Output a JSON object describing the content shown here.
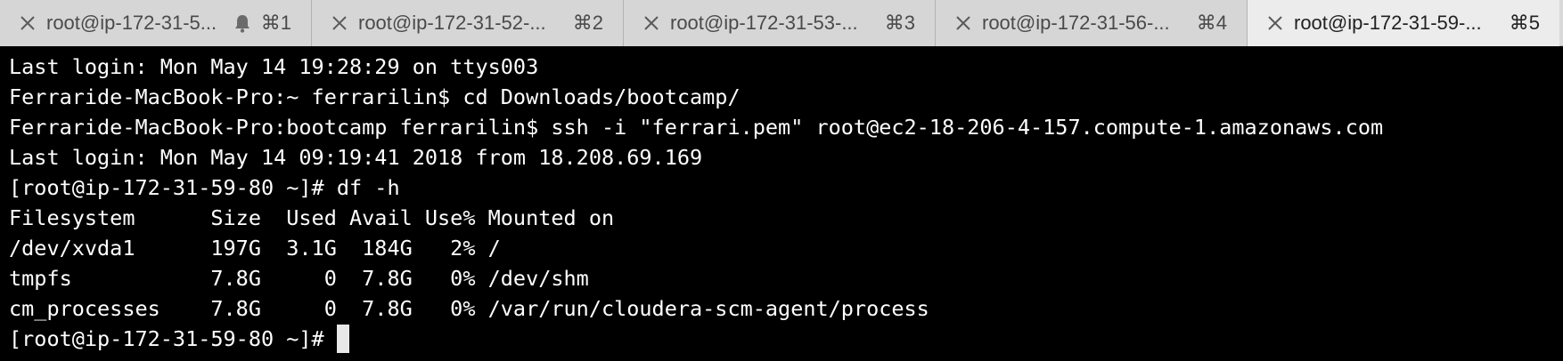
{
  "tabs": [
    {
      "title": "root@ip-172-31-5...",
      "shortcut": "⌘1",
      "active": false,
      "has_bell": true
    },
    {
      "title": "root@ip-172-31-52-...",
      "shortcut": "⌘2",
      "active": false,
      "has_bell": false
    },
    {
      "title": "root@ip-172-31-53-...",
      "shortcut": "⌘3",
      "active": false,
      "has_bell": false
    },
    {
      "title": "root@ip-172-31-56-...",
      "shortcut": "⌘4",
      "active": false,
      "has_bell": false
    },
    {
      "title": "root@ip-172-31-59-...",
      "shortcut": "⌘5",
      "active": true,
      "has_bell": false
    }
  ],
  "icons": {
    "close": "close-icon",
    "bell": "bell-icon"
  },
  "terminal": {
    "lines": [
      "Last login: Mon May 14 19:28:29 on ttys003",
      "Ferraride-MacBook-Pro:~ ferrarilin$ cd Downloads/bootcamp/",
      "Ferraride-MacBook-Pro:bootcamp ferrarilin$ ssh -i \"ferrari.pem\" root@ec2-18-206-4-157.compute-1.amazonaws.com",
      "Last login: Mon May 14 09:19:41 2018 from 18.208.69.169",
      "[root@ip-172-31-59-80 ~]# df -h",
      "Filesystem      Size  Used Avail Use% Mounted on",
      "/dev/xvda1      197G  3.1G  184G   2% /",
      "tmpfs           7.8G     0  7.8G   0% /dev/shm",
      "cm_processes    7.8G     0  7.8G   0% /var/run/cloudera-scm-agent/process"
    ],
    "prompt": "[root@ip-172-31-59-80 ~]# "
  },
  "colors": {
    "terminal_bg": "#000000",
    "terminal_fg": "#ffffff",
    "tabbar_bg": "#d9d9d9",
    "active_tab_bg": "#ececec"
  }
}
